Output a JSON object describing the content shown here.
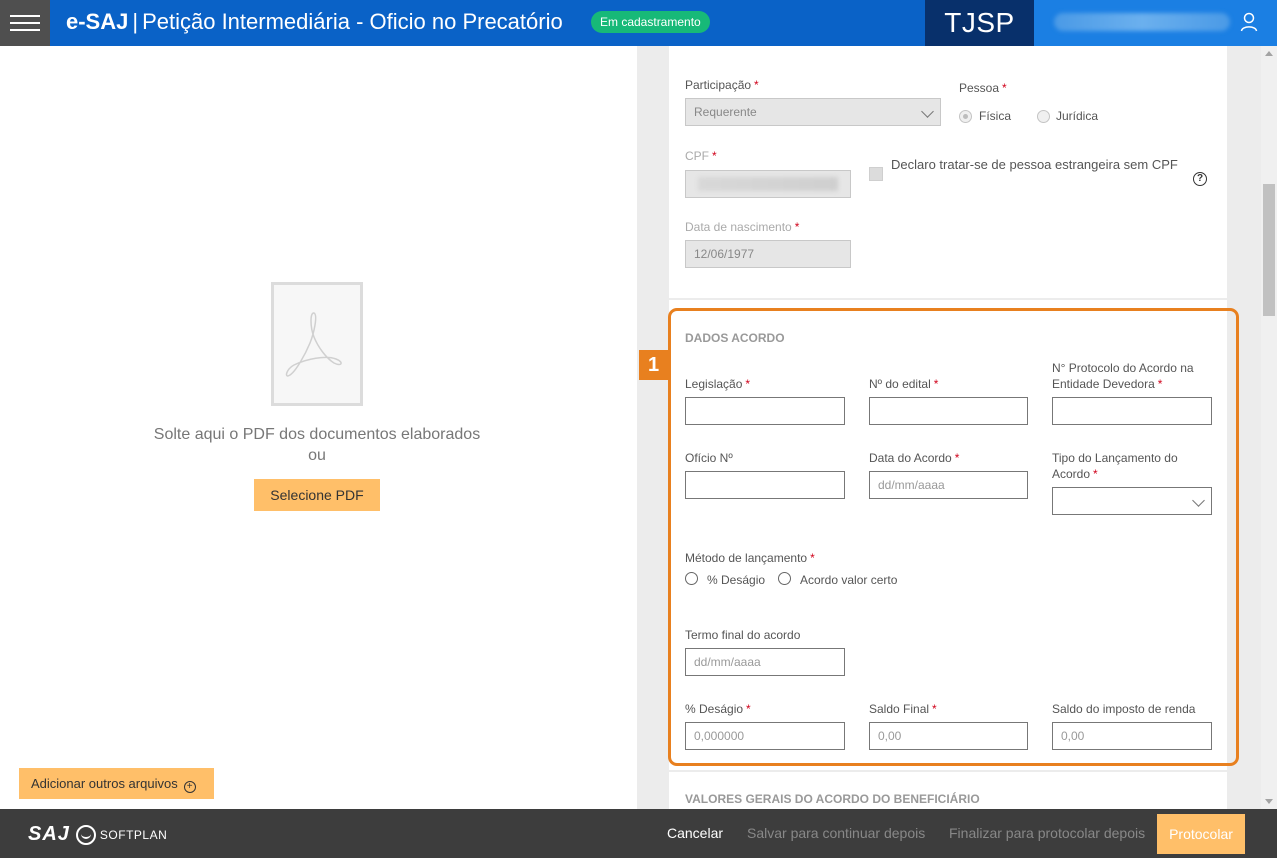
{
  "header": {
    "brand": "e-SAJ",
    "separator": "|",
    "page_title": "Petição Intermediária - Oficio no Precatório",
    "status_badge": "Em cadastramento",
    "court": "TJSP"
  },
  "left_pane": {
    "drop_text": "Solte aqui o PDF dos documentos elaborados ou",
    "select_pdf_button": "Selecione PDF",
    "add_files_button": "Adicionar outros arquivos"
  },
  "person": {
    "participacao_label": "Participação",
    "participacao_value": "Requerente",
    "pessoa_label": "Pessoa",
    "pessoa_options": [
      "Física",
      "Jurídica"
    ],
    "pessoa_selected": "Física",
    "cpf_label": "CPF",
    "foreign_checkbox_label": "Declaro tratar-se de pessoa estrangeira sem CPF",
    "birth_label": "Data de nascimento",
    "birth_value": "12/06/1977",
    "required_mark": "*",
    "help_icon_glyph": "?"
  },
  "acordo": {
    "step_number": "1",
    "section_title": "DADOS ACORDO",
    "legislacao_label": "Legislação",
    "edital_label": "Nº do edital",
    "protocolo_label": "N° Protocolo do Acordo na Entidade Devedora",
    "oficio_label": "Ofício Nº",
    "data_acordo_label": "Data do Acordo",
    "data_acordo_placeholder": "dd/mm/aaaa",
    "tipo_label": "Tipo do Lançamento do Acordo",
    "metodo_label": "Método de lançamento",
    "metodo_options": [
      "% Deságio",
      "Acordo valor certo"
    ],
    "termo_label": "Termo final do acordo",
    "termo_placeholder": "dd/mm/aaaa",
    "desagio_label": "% Deságio",
    "desagio_value": "0,000000",
    "saldo_final_label": "Saldo Final",
    "saldo_final_value": "0,00",
    "saldo_ir_label": "Saldo do imposto de renda",
    "saldo_ir_value": "0,00",
    "highlight_color": "#e8801f"
  },
  "valores": {
    "section_title": "VALORES GERAIS DO ACORDO DO BENEFICIÁRIO"
  },
  "footer": {
    "logo_saj": "SAJ",
    "logo_softplan": "SOFTPLAN",
    "cancel": "Cancelar",
    "save_later": "Salvar para continuar depois",
    "finalize_later": "Finalizar para protocolar depois",
    "protocol": "Protocolar"
  },
  "colors": {
    "header_blue": "#0a62c7",
    "court_navy": "#08306b",
    "badge_green": "#17b978",
    "button_orange": "#ffbf69"
  }
}
